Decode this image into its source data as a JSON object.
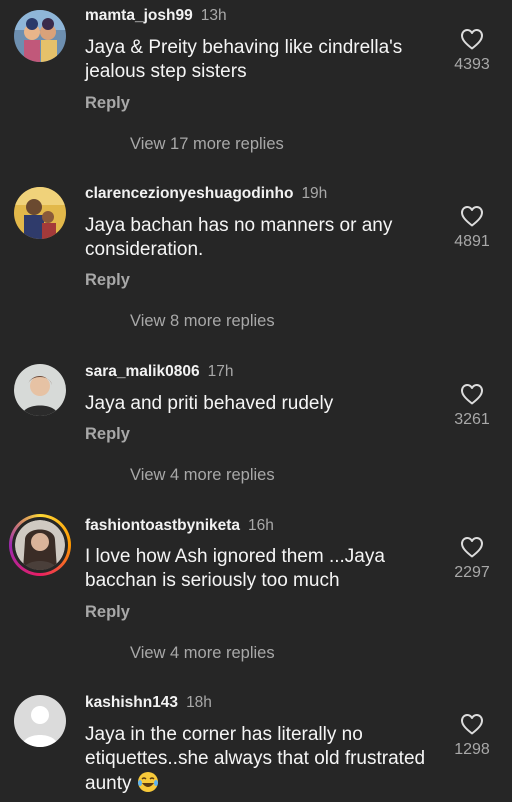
{
  "comments": [
    {
      "username": "mamta_josh99",
      "time": "13h",
      "text": "Jaya & Preity behaving like cindrella's jealous step sisters",
      "likes": "4393",
      "reply_label": "Reply",
      "view_replies": "View 17 more replies",
      "avatar": "deity-painting-avatar"
    },
    {
      "username": "clarencezionyeshuagodinho",
      "time": "19h",
      "text": "Jaya bachan has no manners or any consideration.",
      "likes": "4891",
      "reply_label": "Reply",
      "view_replies": "View 8 more replies",
      "avatar": "family-photo-avatar"
    },
    {
      "username": "sara_malik0806",
      "time": "17h",
      "text": "Jaya and priti behaved rudely",
      "likes": "3261",
      "reply_label": "Reply",
      "view_replies": "View 4 more replies",
      "avatar": "woman-portrait-avatar"
    },
    {
      "username": "fashiontoastbyniketa",
      "time": "16h",
      "text": "I love how Ash  ignored them ...Jaya bacchan is seriously too much",
      "likes": "2297",
      "reply_label": "Reply",
      "view_replies": "View 4 more replies",
      "avatar": "story-ring-avatar"
    },
    {
      "username": "kashishn143",
      "time": "18h",
      "text": "Jaya in the corner has literally no etiquettes..she always that old frustrated aunty",
      "text_emoji": "laughing-tears-emoji",
      "likes": "1298",
      "avatar": "default-avatar"
    }
  ],
  "icons": {
    "like": "heart-outline-icon"
  },
  "colors": {
    "background": "#262626",
    "text_primary": "#f5f5f5",
    "text_secondary": "#a8a8a8"
  }
}
